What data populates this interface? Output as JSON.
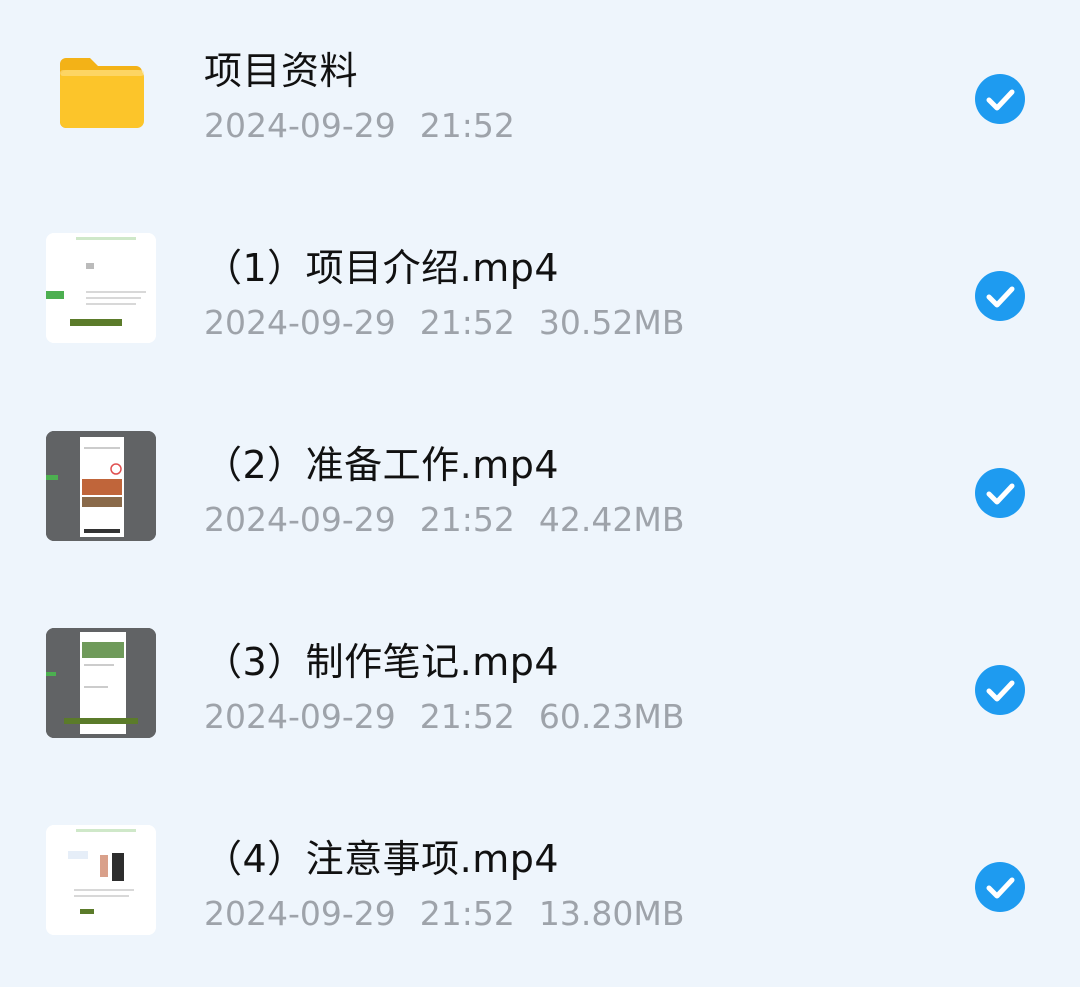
{
  "files": [
    {
      "name": "项目资料",
      "date": "2024-09-29",
      "time": "21:52",
      "size": "",
      "type": "folder",
      "thumb_icon": "folder-icon",
      "selected": true
    },
    {
      "name": "（1）项目介绍.mp4",
      "date": "2024-09-29",
      "time": "21:52",
      "size": "30.52MB",
      "type": "video",
      "thumb_icon": "video-thumbnail",
      "selected": true
    },
    {
      "name": "（2）准备工作.mp4",
      "date": "2024-09-29",
      "time": "21:52",
      "size": "42.42MB",
      "type": "video",
      "thumb_icon": "video-thumbnail",
      "selected": true
    },
    {
      "name": "（3）制作笔记.mp4",
      "date": "2024-09-29",
      "time": "21:52",
      "size": "60.23MB",
      "type": "video",
      "thumb_icon": "video-thumbnail",
      "selected": true
    },
    {
      "name": "（4）注意事项.mp4",
      "date": "2024-09-29",
      "time": "21:52",
      "size": "13.80MB",
      "type": "video",
      "thumb_icon": "video-thumbnail",
      "selected": true
    }
  ],
  "colors": {
    "background": "#eef5fc",
    "check_accent": "#1e9bf0",
    "folder": "#fcc52a",
    "meta_text": "#9ea3aa"
  }
}
